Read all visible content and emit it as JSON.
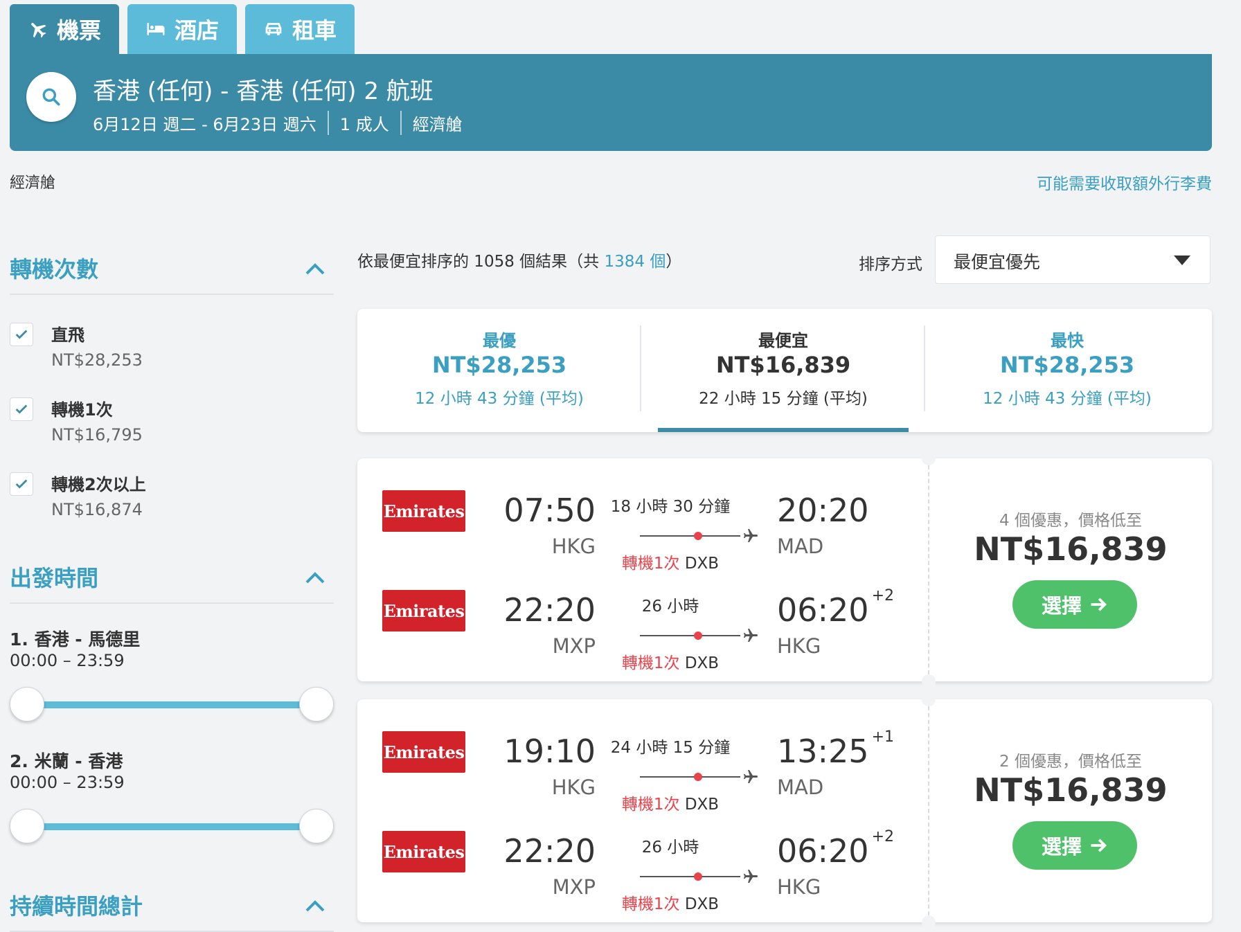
{
  "tabs": [
    {
      "label": "機票",
      "icon": "plane-icon",
      "active": true
    },
    {
      "label": "酒店",
      "icon": "bed-icon",
      "active": false
    },
    {
      "label": "租車",
      "icon": "car-icon",
      "active": false
    }
  ],
  "search": {
    "title": "香港 (任何) - 香港 (任何) 2 航班",
    "dates": "6月12日 週二 - 6月23日 週六",
    "passengers": "1 成人",
    "cabin": "經濟艙"
  },
  "cabin_label": "經濟艙",
  "baggage_link": "可能需要收取額外行李費",
  "filters": {
    "stops": {
      "title": "轉機次數",
      "options": [
        {
          "label": "直飛",
          "price": "NT$28,253",
          "checked": true
        },
        {
          "label": "轉機1次",
          "price": "NT$16,795",
          "checked": true
        },
        {
          "label": "轉機2次以上",
          "price": "NT$16,874",
          "checked": true
        }
      ]
    },
    "departure": {
      "title": "出發時間",
      "routes": [
        {
          "label": "1. 香港 - 馬德里",
          "range": "00:00 – 23:59"
        },
        {
          "label": "2. 米蘭 - 香港",
          "range": "00:00 – 23:59"
        }
      ]
    },
    "duration": {
      "title": "持續時間總計"
    }
  },
  "results": {
    "prefix": "依最便宜排序的 1058 個結果（共 ",
    "total": "1384 個",
    "suffix": "）"
  },
  "sort": {
    "label": "排序方式",
    "value": "最便宜優先"
  },
  "summary": [
    {
      "label": "最優",
      "price": "NT$28,253",
      "duration": "12 小時 43 分鐘 (平均)"
    },
    {
      "label": "最便宜",
      "price": "NT$16,839",
      "duration": "22 小時 15 分鐘 (平均)"
    },
    {
      "label": "最快",
      "price": "NT$28,253",
      "duration": "12 小時 43 分鐘 (平均)"
    }
  ],
  "flights": [
    {
      "legs": [
        {
          "airline": "Emirates",
          "dep_time": "07:50",
          "dep_code": "HKG",
          "duration": "18 小時 30 分鐘",
          "stops": "轉機1次",
          "via": "DXB",
          "arr_time": "20:20",
          "arr_offset": "",
          "arr_code": "MAD"
        },
        {
          "airline": "Emirates",
          "dep_time": "22:20",
          "dep_code": "MXP",
          "duration": "26 小時",
          "stops": "轉機1次",
          "via": "DXB",
          "arr_time": "06:20",
          "arr_offset": "+2",
          "arr_code": "HKG"
        }
      ],
      "offers": "4 個優惠，價格低至",
      "price": "NT$16,839",
      "select_label": "選擇"
    },
    {
      "legs": [
        {
          "airline": "Emirates",
          "dep_time": "19:10",
          "dep_code": "HKG",
          "duration": "24 小時 15 分鐘",
          "stops": "轉機1次",
          "via": "DXB",
          "arr_time": "13:25",
          "arr_offset": "+1",
          "arr_code": "MAD"
        },
        {
          "airline": "Emirates",
          "dep_time": "22:20",
          "dep_code": "MXP",
          "duration": "26 小時",
          "stops": "轉機1次",
          "via": "DXB",
          "arr_time": "06:20",
          "arr_offset": "+2",
          "arr_code": "HKG"
        }
      ],
      "offers": "2 個優惠，價格低至",
      "price": "NT$16,839",
      "select_label": "選擇"
    }
  ],
  "colors": {
    "primary": "#3b8ba7",
    "tab_inactive": "#5bbbd8",
    "link": "#3a9fc0",
    "stop_red": "#e8424b",
    "select_green": "#4fc16a",
    "emirates_red": "#d2232a"
  }
}
